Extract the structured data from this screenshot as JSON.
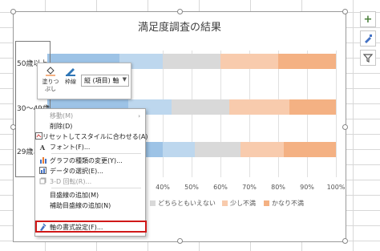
{
  "chart": {
    "title": "満足度調査の結果",
    "categories": [
      "50歳以上",
      "30～49歳",
      "29歳以下"
    ],
    "legend": [
      "どちらともいえない",
      "少し不満",
      "かなり不満"
    ],
    "ticks": [
      "40%",
      "50%",
      "60%",
      "70%",
      "80%",
      "90%",
      "100%"
    ]
  },
  "chart_data": {
    "type": "bar",
    "orientation": "horizontal",
    "stacked": "percent",
    "title": "満足度調査の結果",
    "categories": [
      "50歳以上",
      "30～49歳",
      "29歳以下"
    ],
    "xlim": [
      0,
      100
    ],
    "series": [
      {
        "name": "",
        "color": "#9dc3e6",
        "values": [
          25,
          28,
          40
        ]
      },
      {
        "name": "",
        "color": "#bdd7ee",
        "values": [
          15,
          15,
          11
        ]
      },
      {
        "name": "どちらともいえない",
        "color": "#d9d9d9",
        "values": [
          20,
          20,
          16
        ]
      },
      {
        "name": "少し不満",
        "color": "#f8cbad",
        "values": [
          20,
          21,
          15
        ]
      },
      {
        "name": "かなり不満",
        "color": "#f4b183",
        "values": [
          20,
          16,
          18
        ]
      }
    ]
  },
  "mini_toolbar": {
    "fill_label": "塗りつぶし",
    "outline_label": "枠線",
    "element_select": "縦 (項目) 軸"
  },
  "context_menu": {
    "items": [
      {
        "label": "移動(M)",
        "disabled": true,
        "submenu": true
      },
      {
        "label": "削除(D)"
      },
      {
        "label": "リセットしてスタイルに合わせる(A)"
      },
      {
        "label": "フォント(F)..."
      },
      {
        "label": "グラフの種類の変更(Y)..."
      },
      {
        "label": "データの選択(E)..."
      },
      {
        "label": "3-D 回転(R)...",
        "disabled": true
      },
      {
        "label": "目盛線の追加(M)"
      },
      {
        "label": "補助目盛線の追加(N)"
      },
      {
        "label": "軸の書式設定(F)..."
      }
    ]
  },
  "side_buttons": [
    "plus-icon",
    "brush-icon",
    "filter-icon"
  ]
}
